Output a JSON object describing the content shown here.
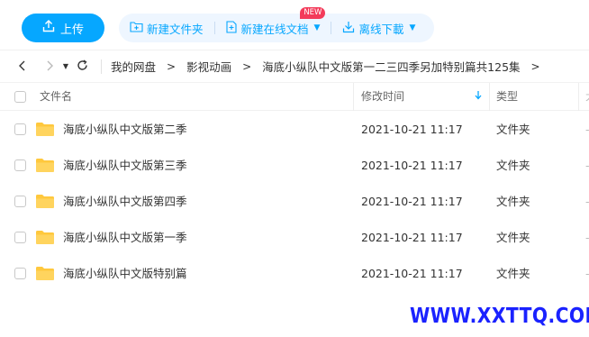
{
  "toolbar": {
    "upload_label": "上传",
    "new_folder_label": "新建文件夹",
    "new_online_doc_label": "新建在线文档",
    "new_badge": "NEW",
    "offline_download_label": "离线下載",
    "accent_color": "#06a7ff"
  },
  "nav": {
    "back_icon": "chevron-left-icon",
    "forward_icon": "chevron-right-icon",
    "history_icon": "caret-down-icon",
    "refresh_icon": "refresh-icon",
    "breadcrumb": [
      "我的网盘",
      "影视动画",
      "海底小纵队中文版第一二三四季另加特别篇共125集"
    ]
  },
  "table": {
    "columns": {
      "name": "文件名",
      "modified": "修改时间",
      "type": "类型",
      "size": "大"
    },
    "rows": [
      {
        "name": "海底小纵队中文版第二季",
        "modified": "2021-10-21 11:17",
        "type": "文件夹"
      },
      {
        "name": "海底小纵队中文版第三季",
        "modified": "2021-10-21 11:17",
        "type": "文件夹"
      },
      {
        "name": "海底小纵队中文版第四季",
        "modified": "2021-10-21 11:17",
        "type": "文件夹"
      },
      {
        "name": "海底小纵队中文版第一季",
        "modified": "2021-10-21 11:17",
        "type": "文件夹"
      },
      {
        "name": "海底小纵队中文版特别篇",
        "modified": "2021-10-21 11:17",
        "type": "文件夹"
      }
    ]
  },
  "watermark": "WWW.XXTTQ.COM"
}
